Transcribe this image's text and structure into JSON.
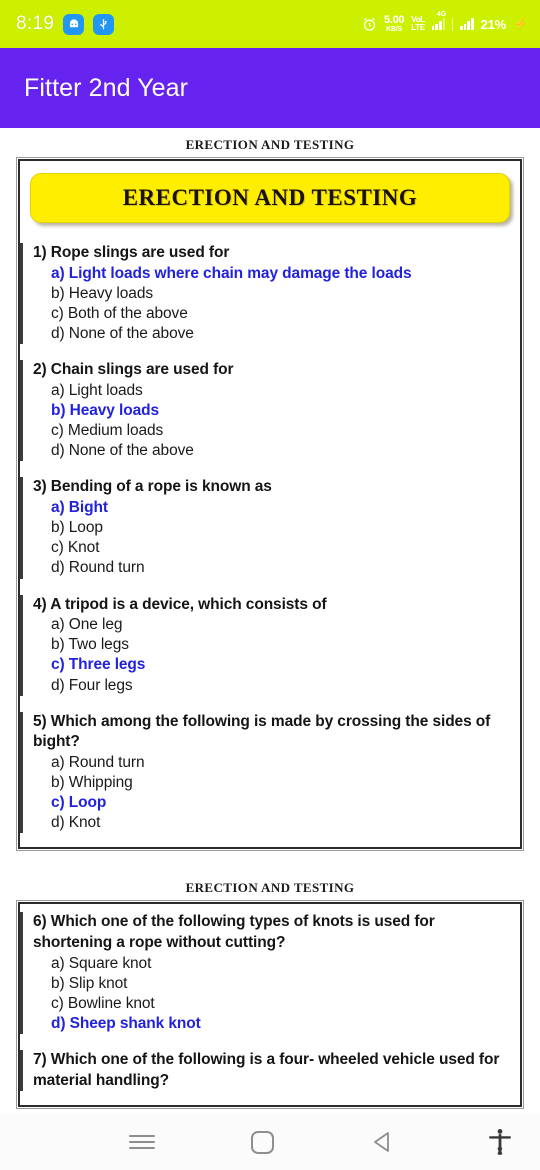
{
  "status_bar": {
    "clock": "8:19",
    "notification_icons": [
      "android-robot-icon",
      "usb-icon"
    ],
    "alarm_icon": "alarm-clock-icon",
    "net_speed_value": "5.00",
    "net_speed_unit": "KB/S",
    "volte_line1": "VoL",
    "volte_line2": "LTE",
    "sim_label": "4G",
    "battery_percent": "21%",
    "charging_icon": "lightning-bolt-icon",
    "background_color": "#ccf000",
    "text_color": "#ffffff"
  },
  "app_bar": {
    "title": "Fitter 2nd Year",
    "background_color": "#6622ee"
  },
  "document": {
    "accent_answer_color": "#2222dd",
    "banner_color": "#ffee00",
    "pages": [
      {
        "caption": "ERECTION AND TESTING",
        "banner": "ERECTION AND TESTING",
        "questions": [
          {
            "number": "1)",
            "text": "1) Rope slings are used for",
            "options": [
              {
                "label": "a) Light loads where chain may damage the loads",
                "correct": true
              },
              {
                "label": "b) Heavy loads",
                "correct": false
              },
              {
                "label": "c) Both of the above",
                "correct": false
              },
              {
                "label": "d) None of the above",
                "correct": false
              }
            ]
          },
          {
            "number": "2)",
            "text": "2) Chain slings are used for",
            "options": [
              {
                "label": "a) Light loads",
                "correct": false
              },
              {
                "label": "b) Heavy loads",
                "correct": true
              },
              {
                "label": "c) Medium loads",
                "correct": false
              },
              {
                "label": "d) None of the above",
                "correct": false
              }
            ]
          },
          {
            "number": "3)",
            "text": "3) Bending of a rope is known as",
            "options": [
              {
                "label": "a) Bight",
                "correct": true
              },
              {
                "label": "b) Loop",
                "correct": false
              },
              {
                "label": "c) Knot",
                "correct": false
              },
              {
                "label": "d) Round turn",
                "correct": false
              }
            ]
          },
          {
            "number": "4)",
            "text": "4) A tripod is a device, which consists of",
            "options": [
              {
                "label": "a) One leg",
                "correct": false
              },
              {
                "label": "b) Two legs",
                "correct": false
              },
              {
                "label": "c) Three legs",
                "correct": true
              },
              {
                "label": "d) Four legs",
                "correct": false
              }
            ]
          },
          {
            "number": "5)",
            "text": "5) Which among the following is made by crossing the sides of bight?",
            "options": [
              {
                "label": "a) Round turn",
                "correct": false
              },
              {
                "label": "b) Whipping",
                "correct": false
              },
              {
                "label": "c) Loop",
                "correct": true
              },
              {
                "label": "d) Knot",
                "correct": false
              }
            ]
          }
        ]
      },
      {
        "caption": "ERECTION AND TESTING",
        "questions": [
          {
            "number": "6)",
            "text": "6) Which one of the following types of knots is used for shortening a rope without cutting?",
            "options": [
              {
                "label": "a) Square knot",
                "correct": false
              },
              {
                "label": "b) Slip knot",
                "correct": false
              },
              {
                "label": "c) Bowline knot",
                "correct": false
              },
              {
                "label": "d) Sheep shank knot",
                "correct": true
              }
            ]
          },
          {
            "number": "7)",
            "text": "7) Which one of the following is a four- wheeled vehicle used for material handling?",
            "options": []
          }
        ]
      }
    ]
  },
  "nav_bar": {
    "recents_icon": "recents-menu-icon",
    "home_icon": "home-square-icon",
    "back_icon": "back-triangle-icon",
    "accessibility_icon": "accessibility-person-icon"
  }
}
